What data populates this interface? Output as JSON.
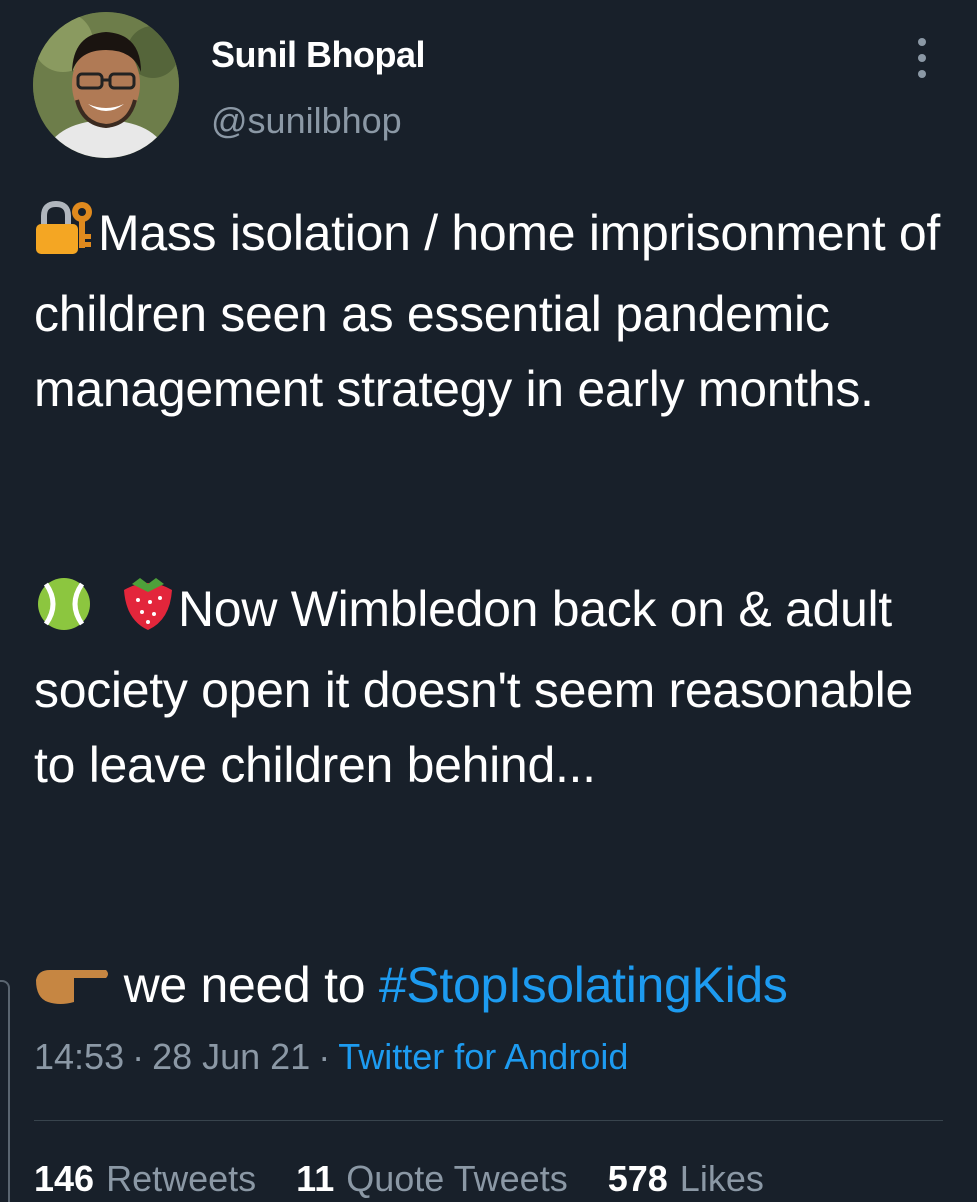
{
  "author": {
    "name": "Sunil Bhopal",
    "handle": "@sunilbhop"
  },
  "tweet": {
    "paragraph1": "Mass isolation / home imprisonment of children seen as essential pandemic management strategy in early months.",
    "paragraph2": "Now Wimbledon back on & adult society open it doesn't seem reasonable to leave children behind...",
    "paragraph3_text": "we need to ",
    "hashtag": "#StopIsolatingKids",
    "emoji": {
      "p1": "locked-with-key-icon",
      "p2": [
        "tennis-ball-icon",
        "strawberry-icon"
      ],
      "p3": "pointing-right-hand-icon"
    }
  },
  "meta": {
    "time": "14:53",
    "date": "28 Jun 21",
    "separator": "·",
    "source": "Twitter for Android"
  },
  "stats": {
    "retweets_count": "146",
    "retweets_label": "Retweets",
    "quotes_count": "11",
    "quotes_label": "Quote Tweets",
    "likes_count": "578",
    "likes_label": "Likes"
  },
  "colors": {
    "background": "#18202a",
    "text": "#ffffff",
    "secondary": "#8b98a5",
    "accent": "#1d9bf0"
  }
}
